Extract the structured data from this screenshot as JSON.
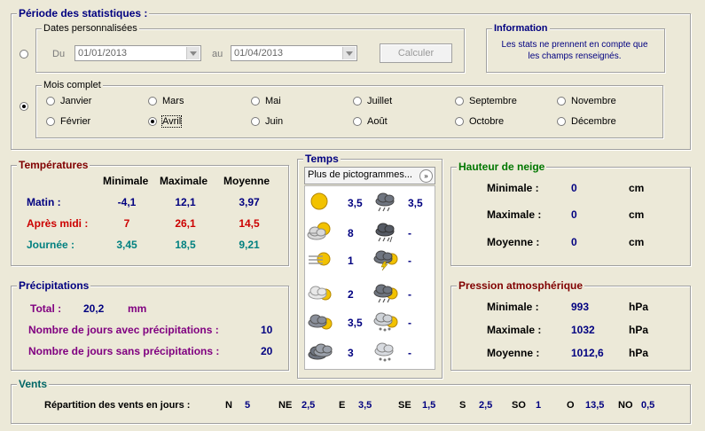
{
  "periode": {
    "title": "Période des statistiques :",
    "dates": {
      "legend": "Dates personnalisées",
      "du_label": "Du",
      "du_value": "01/01/2013",
      "au_label": "au",
      "au_value": "01/04/2013",
      "calc_button": "Calculer"
    },
    "info": {
      "title": "Information",
      "text1": "Les stats ne prennent en compte que",
      "text2": "les champs renseignés."
    },
    "mois": {
      "legend": "Mois complet",
      "months": [
        "Janvier",
        "Mars",
        "Mai",
        "Juillet",
        "Septembre",
        "Novembre",
        "Février",
        "Avril",
        "Juin",
        "Août",
        "Octobre",
        "Décembre"
      ],
      "selected": "Avril"
    }
  },
  "temperatures": {
    "title": "Températures",
    "headers": [
      "Minimale",
      "Maximale",
      "Moyenne"
    ],
    "rows": [
      {
        "label": "Matin :",
        "values": [
          "-4,1",
          "12,1",
          "3,97"
        ]
      },
      {
        "label": "Après midi :",
        "values": [
          "7",
          "26,1",
          "14,5"
        ]
      },
      {
        "label": "Journée :",
        "values": [
          "3,45",
          "18,5",
          "9,21"
        ]
      }
    ]
  },
  "precipitations": {
    "title": "Précipitations",
    "total_label": "Total :",
    "total_value": "20,2",
    "total_unit": "mm",
    "avec_label": "Nombre de jours avec précipitations :",
    "avec_value": "10",
    "sans_label": "Nombre de jours sans précipitations :",
    "sans_value": "20"
  },
  "temps": {
    "title": "Temps",
    "dropdown": "Plus de pictogrammes...",
    "left": [
      {
        "icon": "sun-icon",
        "value": "3,5"
      },
      {
        "icon": "sun-cloud-icon",
        "value": "8"
      },
      {
        "icon": "sun-fog-icon",
        "value": "1"
      },
      {
        "icon": "cloud-sun-icon",
        "value": "2"
      },
      {
        "icon": "dark-cloud-sun-icon",
        "value": "3,5"
      },
      {
        "icon": "cloud-icon",
        "value": "3"
      }
    ],
    "right": [
      {
        "icon": "rain-icon",
        "value": "3,5"
      },
      {
        "icon": "storm-icon",
        "value": "-"
      },
      {
        "icon": "thunder-sun-icon",
        "value": "-"
      },
      {
        "icon": "rain-sun-icon",
        "value": "-"
      },
      {
        "icon": "snow-sun-icon",
        "value": "-"
      },
      {
        "icon": "snow-icon",
        "value": "-"
      }
    ]
  },
  "neige": {
    "title": "Hauteur de neige",
    "rows": [
      {
        "label": "Minimale :",
        "value": "0",
        "unit": "cm"
      },
      {
        "label": "Maximale :",
        "value": "0",
        "unit": "cm"
      },
      {
        "label": "Moyenne :",
        "value": "0",
        "unit": "cm"
      }
    ]
  },
  "pression": {
    "title": "Pression atmosphérique",
    "rows": [
      {
        "label": "Minimale :",
        "value": "993",
        "unit": "hPa"
      },
      {
        "label": "Maximale :",
        "value": "1032",
        "unit": "hPa"
      },
      {
        "label": "Moyenne :",
        "value": "1012,6",
        "unit": "hPa"
      }
    ]
  },
  "vents": {
    "title": "Vents",
    "label": "Répartition des vents en jours :",
    "items": [
      {
        "dir": "N",
        "value": "5"
      },
      {
        "dir": "NE",
        "value": "2,5"
      },
      {
        "dir": "E",
        "value": "3,5"
      },
      {
        "dir": "SE",
        "value": "1,5"
      },
      {
        "dir": "S",
        "value": "2,5"
      },
      {
        "dir": "SO",
        "value": "1"
      },
      {
        "dir": "O",
        "value": "13,5"
      },
      {
        "dir": "NO",
        "value": "0,5"
      }
    ]
  }
}
